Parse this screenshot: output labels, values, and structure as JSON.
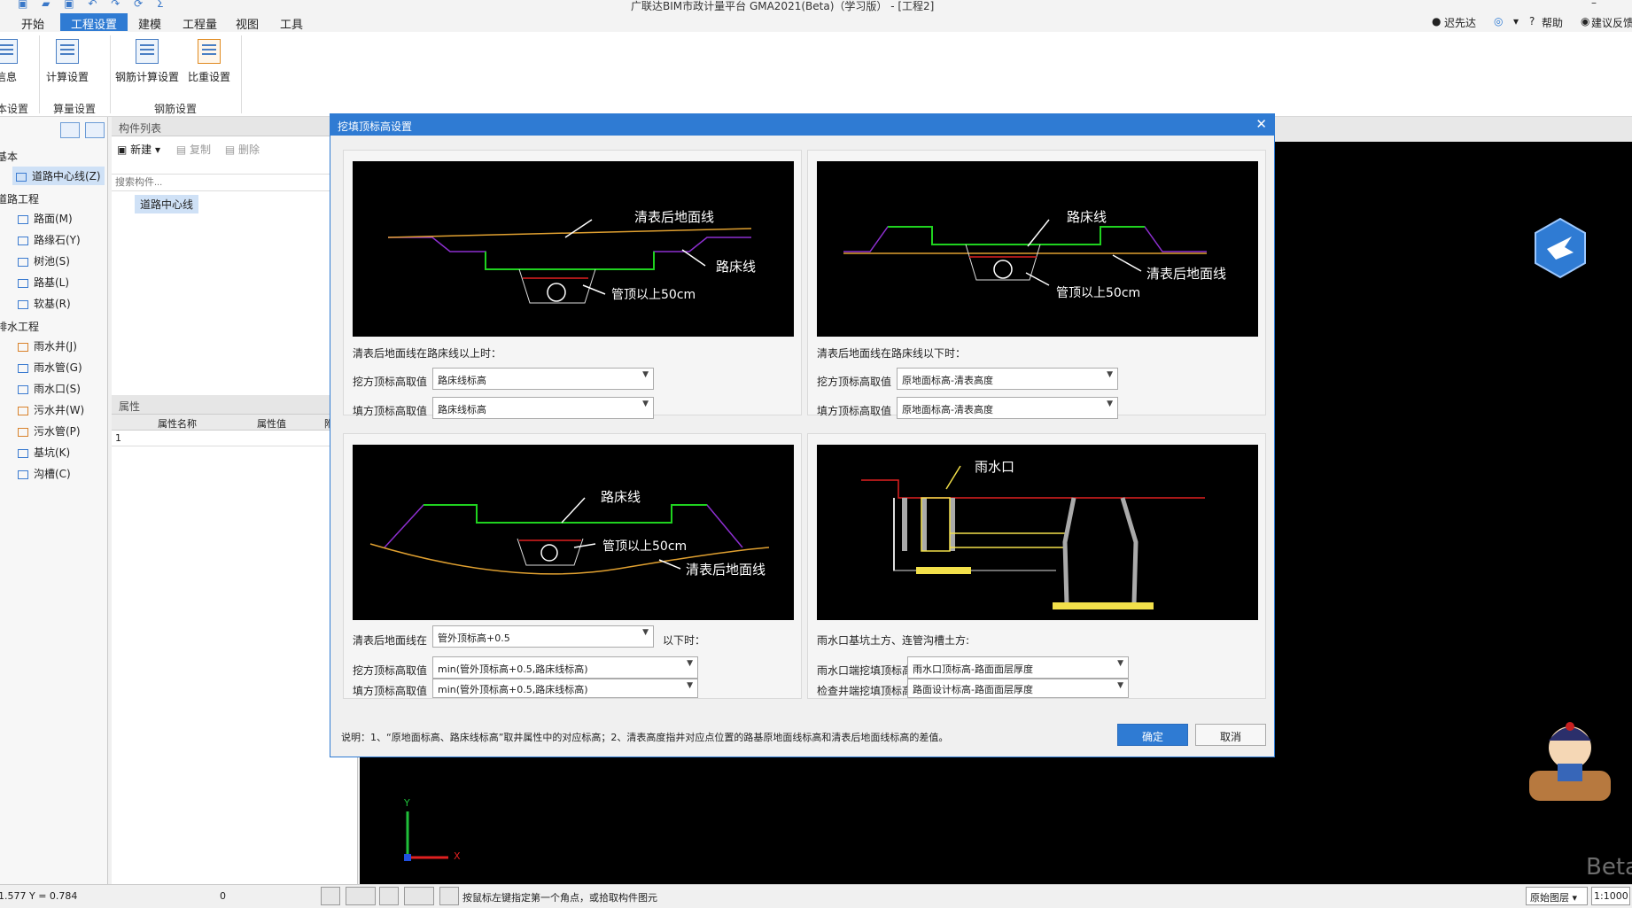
{
  "titlebar": {
    "title": "广联达BIM市政计量平台 GMA2021(Beta)（学习版） - [工程2]",
    "minimize": "–"
  },
  "menu": {
    "items": [
      "开始",
      "工程设置",
      "建模",
      "工程量",
      "视图",
      "工具"
    ],
    "active_index": 1,
    "user": "迟先达",
    "help": "帮助",
    "feedback": "建议反馈"
  },
  "ribbon": {
    "buttons": [
      {
        "label": "信息"
      },
      {
        "label": "计算设置"
      },
      {
        "label": "钢筋计算设置"
      },
      {
        "label": "比重设置"
      }
    ],
    "groups": [
      "本设置",
      "算量设置",
      "钢筋设置"
    ]
  },
  "tree": {
    "sections": [
      {
        "title": "基本",
        "items": [
          {
            "label": "道路中心线(Z)",
            "selected": true
          }
        ]
      },
      {
        "title": "道路工程",
        "items": [
          {
            "label": "路面(M)"
          },
          {
            "label": "路缘石(Y)"
          },
          {
            "label": "树池(S)"
          },
          {
            "label": "路基(L)"
          },
          {
            "label": "软基(R)"
          }
        ]
      },
      {
        "title": "排水工程",
        "items": [
          {
            "label": "雨水井(J)"
          },
          {
            "label": "雨水管(G)"
          },
          {
            "label": "雨水口(S)"
          },
          {
            "label": "污水井(W)"
          },
          {
            "label": "污水管(P)"
          },
          {
            "label": "基坑(K)"
          },
          {
            "label": "沟槽(C)"
          }
        ]
      }
    ]
  },
  "component_list": {
    "title": "构件列表",
    "new": "新建",
    "copy": "复制",
    "delete": "删除",
    "search_placeholder": "搜索构件...",
    "items": [
      "道路中心线"
    ]
  },
  "properties": {
    "title": "属性",
    "columns": [
      "属性名称",
      "属性值",
      "附"
    ],
    "rows": [
      {
        "num": "1"
      }
    ]
  },
  "dialog": {
    "title": "挖填顶标高设置",
    "q1": {
      "caption": "清表后地面线在路床线以上时：",
      "cut_label": "挖方顶标高取值",
      "cut_value": "路床线标高",
      "fill_label": "填方顶标高取值",
      "fill_value": "路床线标高",
      "diagram": {
        "label_a": "清表后地面线",
        "label_b": "路床线",
        "label_c": "管顶以上50cm"
      }
    },
    "q2": {
      "caption": "清表后地面线在路床线以下时：",
      "cut_label": "挖方顶标高取值",
      "cut_value": "原地面标高-清表高度",
      "fill_label": "填方顶标高取值",
      "fill_value": "原地面标高-清表高度",
      "diagram": {
        "label_a": "路床线",
        "label_b": "清表后地面线",
        "label_c": "管顶以上50cm"
      }
    },
    "q3": {
      "caption_pre": "清表后地面线在",
      "caption_value": "管外顶标高+0.5",
      "caption_post": "以下时：",
      "cut_label": "挖方顶标高取值",
      "cut_value": "min(管外顶标高+0.5,路床线标高)",
      "fill_label": "填方顶标高取值",
      "fill_value": "min(管外顶标高+0.5,路床线标高)",
      "diagram": {
        "label_a": "路床线",
        "label_b": "管顶以上50cm",
        "label_c": "清表后地面线"
      }
    },
    "q4": {
      "caption": "雨水口基坑土方、连管沟槽土方:",
      "cut_label": "雨水口端挖填顶标高",
      "cut_value": "雨水口顶标高-路面面层厚度",
      "fill_label": "检查井端挖填顶标高",
      "fill_value": "路面设计标高-路面面层厚度",
      "diagram": {
        "label_a": "雨水口"
      }
    },
    "note": "说明：1、“原地面标高、路床线标高”取井属性中的对应标高；2、清表高度指井对应点位置的路基原地面线标高和清表后地面线标高的差值。",
    "ok": "确定",
    "cancel": "取消"
  },
  "status": {
    "coords": "1.577 Y = 0.784",
    "zero": "0",
    "hint": "按鼠标左键指定第一个角点，或拾取构件图元",
    "layer": "原始图层",
    "scale": "1:1000"
  },
  "cad": {
    "watermark": "Beta",
    "axis_x": "X",
    "axis_y": "Y"
  }
}
